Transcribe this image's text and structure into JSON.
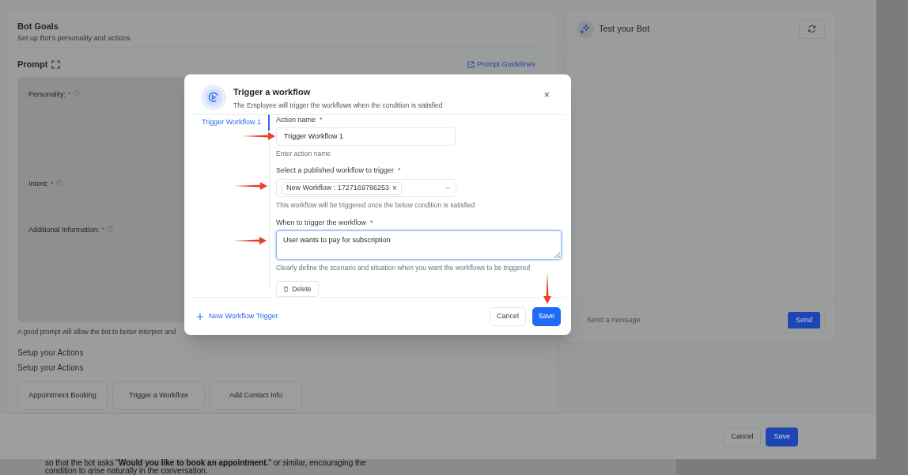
{
  "builder": {
    "title": "Bot Goals",
    "subtitle": "Set up Bot's personality and actions",
    "prompt_heading": "Prompt",
    "guidelines_link": "Prompt Guidelines",
    "fields": [
      {
        "label": "Personality:",
        "required_mark": "*"
      },
      {
        "label": "Intent:",
        "required_mark": "*"
      },
      {
        "label": "Additional Information:",
        "required_mark": "*"
      }
    ],
    "hint": "A good prompt will allow the bot to better interpret and",
    "action_headings": [
      "Setup your Actions",
      "Setup your Actions"
    ],
    "action_buttons": [
      "Appointment Booking",
      "Trigger a Workflow",
      "Add Contact Info"
    ]
  },
  "test_panel": {
    "title": "Test your Bot",
    "message_placeholder": "Send a message",
    "send_button": "Send"
  },
  "footer": {
    "buttons": [
      {
        "label": "Cancel",
        "kind": "secondary"
      },
      {
        "label": "Save",
        "kind": "primary"
      }
    ]
  },
  "modal": {
    "title": "Trigger a workflow",
    "subtitle": "The Employee will trigger the workflows when the condition is satisfied",
    "close": "×",
    "tabs": [
      {
        "label": "Trigger Workflow 1",
        "selected": true
      }
    ],
    "fields": [
      {
        "kind": "input",
        "label": "Action name",
        "required_mark": "*",
        "value": "Trigger Workflow 1",
        "hint": "Enter action name",
        "focused": false
      },
      {
        "kind": "select",
        "label": "Select a published workflow to trigger",
        "required_mark": "*",
        "tags": [
          {
            "label": "New Workflow : 1727169786253",
            "remove": "×"
          }
        ],
        "hint": "This workflow will be triggered once the below condition is satisfied",
        "focused": false
      },
      {
        "kind": "textarea",
        "label": "When to trigger the workflow",
        "required_mark": "*",
        "value": "User wants to pay for subscription",
        "hint": "Clearly define the scenario and situation when you want the workflows to be triggered",
        "focused": true
      }
    ],
    "delete_button": "Delete",
    "add_link": "New Workflow Trigger",
    "buttons": [
      {
        "label": "Cancel",
        "kind": "secondary"
      },
      {
        "label": "Save",
        "kind": "primary"
      }
    ]
  },
  "document": {
    "lines": [
      "so that the bot asks \"**Would you like to book an appointment.**\" or similar, encouraging the",
      "condition to arise naturally in the conversation."
    ]
  }
}
